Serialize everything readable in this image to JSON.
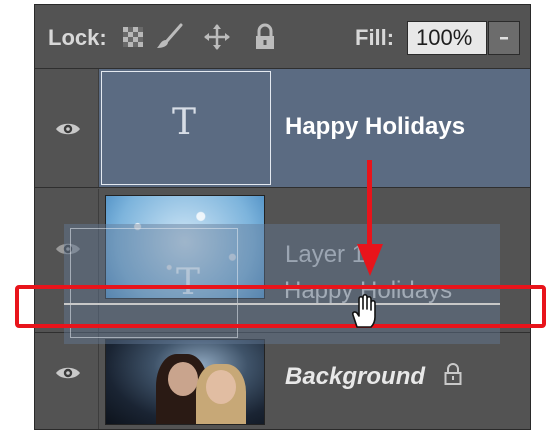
{
  "toolbar": {
    "lock_label": "Lock:",
    "lock_icons": [
      "transparency-pixels-icon",
      "brush-icon",
      "move-icon",
      "padlock-icon"
    ],
    "fill_label": "Fill:",
    "fill_value": "100%"
  },
  "layers": [
    {
      "name": "Happy Holidays",
      "type": "text",
      "selected": true
    },
    {
      "name": "Layer 1",
      "type": "image"
    },
    {
      "name": "Background",
      "type": "image",
      "locked": true
    }
  ],
  "drag": {
    "ghost_name": "Happy Holidays"
  },
  "colors": {
    "panel": "#535353",
    "selected": "#5b6b82",
    "annotation": "#e8141b"
  }
}
